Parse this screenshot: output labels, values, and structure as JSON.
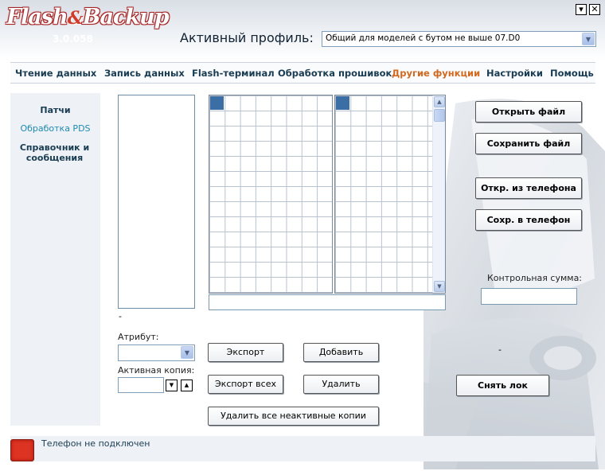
{
  "app": {
    "logo_main": "Flash",
    "logo_amp": "&",
    "logo_tail": "Backup",
    "version": "3.0.058",
    "minimize_glyph": "▾",
    "close_glyph": "✕"
  },
  "profile": {
    "label": "Активный профиль:",
    "value": "Общий для моделей с бутом не выше 07.D0"
  },
  "nav": {
    "items": [
      {
        "label": "Чтение данных"
      },
      {
        "label": "Запись данных"
      },
      {
        "label": "Flash-терминал"
      },
      {
        "label": "Обработка прошивок"
      },
      {
        "label": "Другие функции"
      },
      {
        "label": "Настройки"
      },
      {
        "label": "Помощь"
      }
    ],
    "active_index": 4
  },
  "sidebar": {
    "items": [
      {
        "label": "Патчи"
      },
      {
        "label": "Обработка PDS"
      },
      {
        "label": "Справочник и сообщения"
      }
    ],
    "active_index": 1
  },
  "main": {
    "list_placeholder": "-",
    "attribute_label": "Атрибут:",
    "active_copy_label": "Активная копия:",
    "buttons": {
      "export": "Экспорт",
      "add": "Добавить",
      "export_all": "Экспорт всех",
      "delete": "Удалить",
      "delete_inactive": "Удалить все неактивные копии"
    }
  },
  "right": {
    "open_file": "Открыть файл",
    "save_file": "Сохранить файл",
    "open_from_phone": "Откр. из телефона",
    "save_to_phone": "Сохр. в телефон",
    "checksum_label": "Контрольная сумма:",
    "checksum_value": "",
    "dash": "-",
    "unlock": "Снять лок"
  },
  "status": {
    "text": "Телефон не подключен",
    "led_color": "#dd3322"
  },
  "icons": {
    "dropdown": "chevron-down-icon",
    "spin_down": "triangle-down-icon",
    "spin_up": "triangle-up-icon",
    "status": "status-led-icon"
  }
}
